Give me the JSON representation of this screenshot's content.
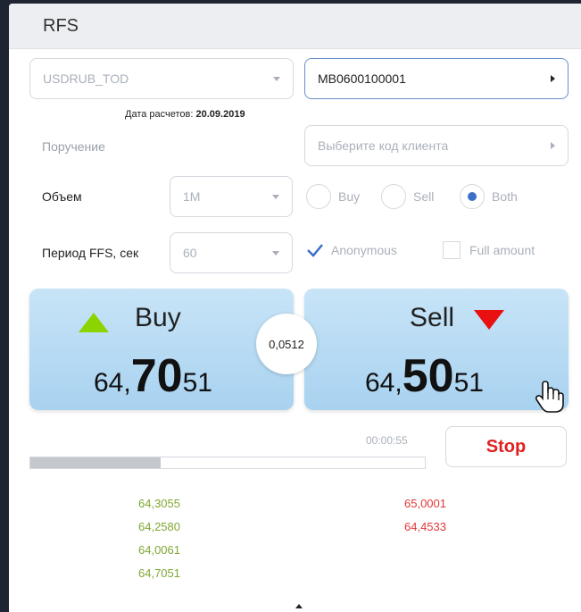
{
  "window": {
    "title": "RFS"
  },
  "instrument": {
    "value": "USDRUB_TOD"
  },
  "account": {
    "value": "MB0600100001"
  },
  "settlement": {
    "label": "Дата расчетов:",
    "date": "20.09.2019"
  },
  "order": {
    "label": "Поручение",
    "placeholder": "Выберите код клиента"
  },
  "volume": {
    "label": "Объем",
    "value": "1M",
    "options": [
      "Buy",
      "Sell",
      "Both"
    ],
    "selected": "Both"
  },
  "period": {
    "label": "Период FFS, сек",
    "value": "60",
    "anonymous_label": "Anonymous",
    "anonymous_checked": true,
    "full_amount_label": "Full amount",
    "full_amount_checked": false
  },
  "buy": {
    "label": "Buy",
    "price_prefix": "64,",
    "price_big": "70",
    "price_suffix": "51",
    "arrow_color": "#8cd400"
  },
  "sell": {
    "label": "Sell",
    "price_prefix": "64,",
    "price_big": "50",
    "price_suffix": "51",
    "arrow_color": "#e81010"
  },
  "spread": "0,0512",
  "timer": "00:00:55",
  "progress": {
    "fraction": 0.33
  },
  "stop_label": "Stop",
  "quotes": {
    "bids": [
      "64,3055",
      "64,2580",
      "64,0061",
      "64,7051"
    ],
    "asks": [
      "65,0001",
      "64,4533"
    ]
  },
  "colors": {
    "bid": "#7ea832",
    "ask": "#e03838",
    "panel": "#b8dcf4",
    "stop": "#e02020"
  }
}
